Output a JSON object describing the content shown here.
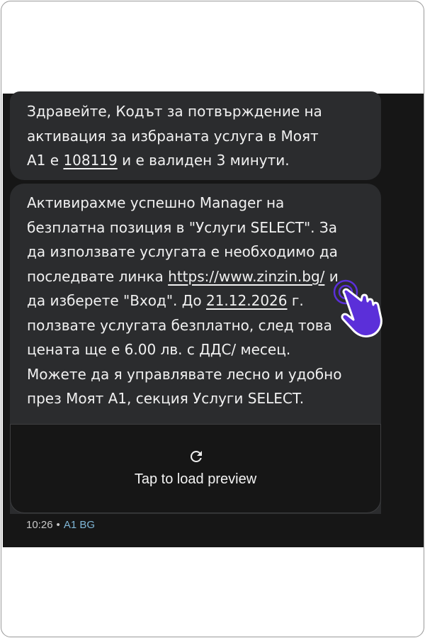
{
  "messages": [
    {
      "line1": "Здравейте, Кодът за потвърждение на",
      "line2": "активация за избраната услуга в Моят",
      "line3_before": "А1 е ",
      "code": "108119",
      "line3_after": " и е валиден 3 минути."
    },
    {
      "line1": "Активирахме успешно Manager на",
      "line2": "безплатна позиция в \"Услуги SELECT\". За",
      "line3": "да използвате услугата е необходимо да",
      "line4_before": "последвате линка ",
      "link": "https://www.zinzin.bg/",
      "line4_after": " и",
      "line5_before": "да изберете \"Вход\".  До ",
      "date": "21.12.2026",
      "line5_after": " г.",
      "line6": "ползвате услугата безплатно, след това",
      "line7": "цената ще е 6.00 лв. с ДДС/ месец.",
      "line8": "Можете да я управлявате лесно и удобно",
      "line9": "през Моят А1, секция Услуги SELECT."
    }
  ],
  "preview": {
    "label": "Tap to load preview",
    "icon": "refresh-icon"
  },
  "meta": {
    "time": "10:26",
    "separator": "•",
    "sender": "A1 BG"
  },
  "pointer": {
    "icon": "hand-pointer-icon",
    "color": "#5b2fd9"
  }
}
